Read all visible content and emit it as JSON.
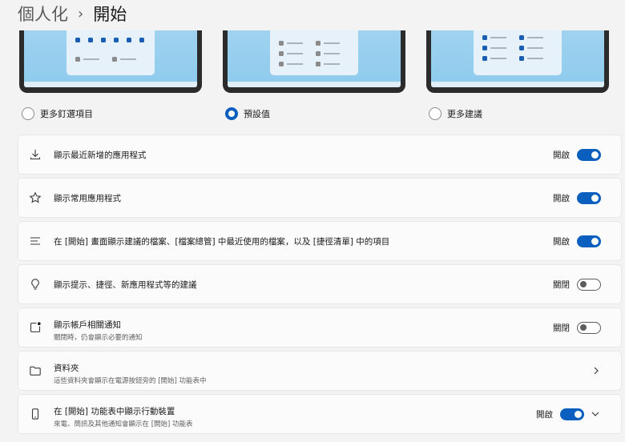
{
  "breadcrumb": {
    "parent": "個人化",
    "separator": "›",
    "current": "開始"
  },
  "layout_options": [
    {
      "label": "更多釘選項目",
      "selected": false
    },
    {
      "label": "預設值",
      "selected": true
    },
    {
      "label": "更多建議",
      "selected": false
    }
  ],
  "settings": [
    {
      "icon": "download-icon",
      "title": "顯示最近新增的應用程式",
      "state": "開啟",
      "on": true
    },
    {
      "icon": "star-icon",
      "title": "顯示常用應用程式",
      "state": "開啟",
      "on": true
    },
    {
      "icon": "list-icon",
      "title": "在 [開始] 畫面顯示建議的檔案、[檔案總管] 中最近使用的檔案，以及 [捷徑清單] 中的項目",
      "state": "開啟",
      "on": true
    },
    {
      "icon": "lightbulb-icon",
      "title": "顯示提示、捷徑、新應用程式等的建議",
      "state": "關閉",
      "on": false
    },
    {
      "icon": "notification-icon",
      "title": "顯示帳戶相關通知",
      "subtitle": "關閉時，仍會顯示必要的通知",
      "state": "關閉",
      "on": false
    },
    {
      "icon": "folder-icon",
      "title": "資料夾",
      "subtitle": "這些資料夾會顯示在電源按鈕旁的 [開始] 功能表中"
    },
    {
      "icon": "phone-icon",
      "title": "在 [開始] 功能表中顯示行動裝置",
      "subtitle": "來電、簡訊及其他通知會顯示在 [開始] 功能表",
      "state": "開啟",
      "on": true
    }
  ],
  "colors": {
    "accent": "#0a5fbf",
    "background": "#f3f3f3",
    "card": "#fbfbfb"
  }
}
